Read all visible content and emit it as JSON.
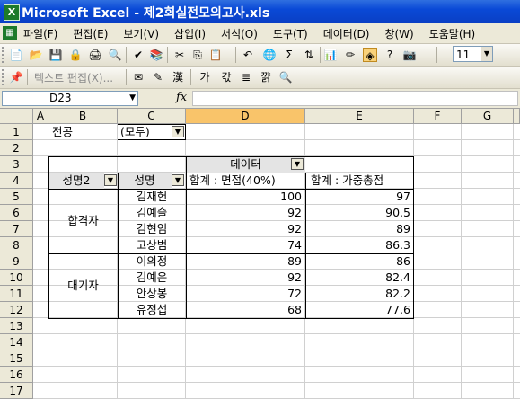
{
  "window": {
    "title": "Microsoft Excel - 제2회실전모의고사.xls"
  },
  "menu": [
    "파일(F)",
    "편집(E)",
    "보기(V)",
    "삽입(I)",
    "서식(O)",
    "도구(T)",
    "데이터(D)",
    "창(W)",
    "도움말(H)"
  ],
  "toolbar": {
    "font_size": "11",
    "text_edit_label": "텍스트 편집(X)...",
    "sigma": "Σ"
  },
  "formula_bar": {
    "name_box": "D23",
    "fx": "fx",
    "formula": ""
  },
  "columns": [
    "A",
    "B",
    "C",
    "D",
    "E",
    "F",
    "G"
  ],
  "rows": [
    "1",
    "2",
    "3",
    "4",
    "5",
    "6",
    "7",
    "8",
    "9",
    "10",
    "11",
    "12",
    "13",
    "14",
    "15",
    "16",
    "17"
  ],
  "pivot": {
    "page_field_label": "전공",
    "page_field_value": "(모두)",
    "data_label": "데이터",
    "row_field1": "성명2",
    "row_field2": "성명",
    "value_header1": "합계 : 면접(40%)",
    "value_header2": "합계 : 가중총점",
    "groups": [
      {
        "name": "합격자",
        "rows": [
          {
            "name": "김재헌",
            "interview": "100",
            "weighted": "97"
          },
          {
            "name": "김예슬",
            "interview": "92",
            "weighted": "90.5"
          },
          {
            "name": "김현임",
            "interview": "92",
            "weighted": "89"
          },
          {
            "name": "고상범",
            "interview": "74",
            "weighted": "86.3"
          }
        ]
      },
      {
        "name": "대기자",
        "rows": [
          {
            "name": "이의정",
            "interview": "89",
            "weighted": "86"
          },
          {
            "name": "김예은",
            "interview": "92",
            "weighted": "82.4"
          },
          {
            "name": "안상봉",
            "interview": "72",
            "weighted": "82.2"
          },
          {
            "name": "유정섭",
            "interview": "68",
            "weighted": "77.6"
          }
        ]
      }
    ]
  }
}
